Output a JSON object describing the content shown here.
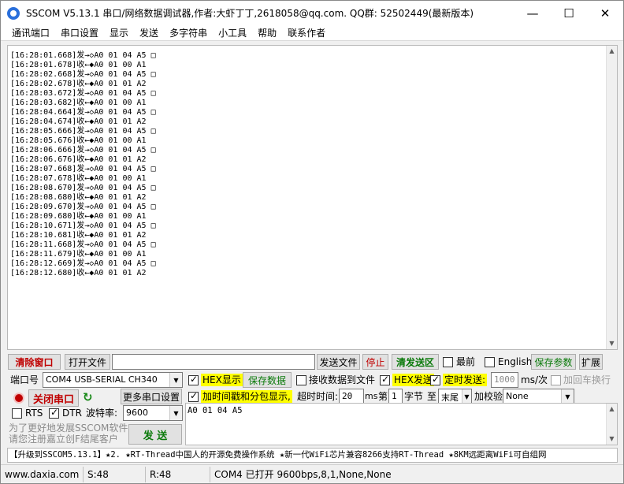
{
  "window": {
    "title": "SSCOM V5.13.1 串口/网络数据调试器,作者:大虾丁丁,2618058@qq.com. QQ群: 52502449(最新版本)",
    "minimize": "—",
    "maximize": "☐",
    "close": "✕"
  },
  "menu": [
    "通讯端口",
    "串口设置",
    "显示",
    "发送",
    "多字符串",
    "小工具",
    "帮助",
    "联系作者"
  ],
  "log": [
    "[16:28:01.668]发→◇A0 01 04 A5 □",
    "[16:28:01.678]收←◆A0 01 00 A1",
    "[16:28:02.668]发→◇A0 01 04 A5 □",
    "[16:28:02.678]收←◆A0 01 01 A2",
    "[16:28:03.672]发→◇A0 01 04 A5 □",
    "[16:28:03.682]收←◆A0 01 00 A1",
    "[16:28:04.664]发→◇A0 01 04 A5 □",
    "[16:28:04.674]收←◆A0 01 01 A2",
    "[16:28:05.666]发→◇A0 01 04 A5 □",
    "[16:28:05.676]收←◆A0 01 00 A1",
    "[16:28:06.666]发→◇A0 01 04 A5 □",
    "[16:28:06.676]收←◆A0 01 01 A2",
    "[16:28:07.668]发→◇A0 01 04 A5 □",
    "[16:28:07.678]收←◆A0 01 00 A1",
    "[16:28:08.670]发→◇A0 01 04 A5 □",
    "[16:28:08.680]收←◆A0 01 01 A2",
    "[16:28:09.670]发→◇A0 01 04 A5 □",
    "[16:28:09.680]收←◆A0 01 00 A1",
    "[16:28:10.671]发→◇A0 01 04 A5 □",
    "[16:28:10.681]收←◆A0 01 01 A2",
    "[16:28:11.668]发→◇A0 01 04 A5 □",
    "[16:28:11.679]收←◆A0 01 00 A1",
    "[16:28:12.669]发→◇A0 01 04 A5 □",
    "[16:28:12.680]收←◆A0 01 01 A2"
  ],
  "toolbar": {
    "clear_window": "清除窗口",
    "open_file": "打开文件",
    "file_path": "",
    "send_file": "发送文件",
    "stop": "停止",
    "clear_send": "清发送区",
    "topmost": "最前",
    "english": "English",
    "save_params": "保存参数",
    "expand": "扩展"
  },
  "port": {
    "port_label": "端口号",
    "port_value": "COM4 USB-SERIAL CH340",
    "close_port": "关闭串口",
    "more_settings": "更多串口设置",
    "rts": "RTS",
    "dtr": "DTR",
    "baud_label": "波特率:",
    "baud_value": "9600"
  },
  "options": {
    "hex_display": "HEX显示",
    "save_data": "保存数据",
    "recv_to_file": "接收数据到文件",
    "hex_send": "HEX发送",
    "timed_send": "定时发送:",
    "timed_value": "1000",
    "timed_unit": "ms/次",
    "add_crlf": "加回车换行",
    "timestamp": "加时间戳和分包显示,",
    "timeout_label": "超时时间:",
    "timeout_value": "20",
    "timeout_unit": "ms",
    "byte_prefix": "第",
    "byte_value": "1",
    "byte_suffix": "字节",
    "to": "至",
    "tail_value": "末尾",
    "checksum_label": "加校验",
    "checksum_value": "None"
  },
  "send": {
    "text": "A0 01 04 A5",
    "send_button": "发 送",
    "promo": "为了更好地发展SSCOM软件\n请您注册嘉立创F结尾客户"
  },
  "ticker": "【升级到SSCOM5.13.1】★2. ★RT-Thread中国人的开源免费操作系统 ★新一代WiFi芯片兼容8266支持RT-Thread ★8KM远距离WiFi可自组网",
  "status": {
    "website": "www.daxia.com",
    "sent": "S:48",
    "received": "R:48",
    "port_state": "COM4 已打开  9600bps,8,1,None,None"
  }
}
